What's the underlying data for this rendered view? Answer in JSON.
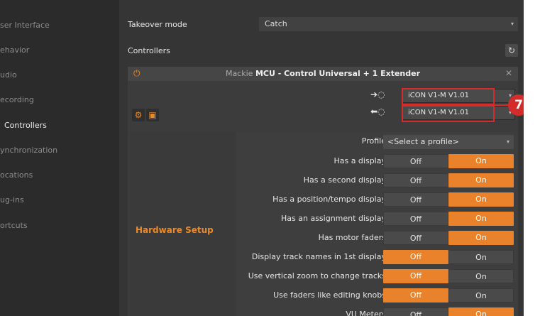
{
  "sidebar": {
    "items": [
      {
        "label": "ser Interface",
        "active": false
      },
      {
        "label": "ehavior",
        "active": false
      },
      {
        "label": "udio",
        "active": false
      },
      {
        "label": "ecording",
        "active": false
      },
      {
        "label": "Controllers",
        "active": true
      },
      {
        "label": "ynchronization",
        "active": false
      },
      {
        "label": "ocations",
        "active": false
      },
      {
        "label": "ug-ins",
        "active": false
      },
      {
        "label": "ortcuts",
        "active": false
      }
    ]
  },
  "takeover": {
    "label": "Takeover mode",
    "value": "Catch"
  },
  "controllers": {
    "label": "Controllers",
    "refresh_icon": "refresh-icon"
  },
  "card": {
    "brand": "Mackie",
    "model": "MCU - Control Universal + 1 Extender",
    "power_icon": "power-icon",
    "close_icon": "close-icon"
  },
  "ports": {
    "input_value": "iCON V1-M V1.01",
    "output_value": "iCON V1-M V1.01"
  },
  "annotation": {
    "number": "7",
    "color": "#d42b2b"
  },
  "hardware_setup": {
    "title": "Hardware Setup",
    "profile_label": "Profile",
    "profile_value": "<Select a profile>",
    "off_label": "Off",
    "on_label": "On",
    "options": [
      {
        "label": "Has a display",
        "state": "on"
      },
      {
        "label": "Has a second display",
        "state": "on"
      },
      {
        "label": "Has a position/tempo display",
        "state": "on"
      },
      {
        "label": "Has an assignment display",
        "state": "on"
      },
      {
        "label": "Has motor faders",
        "state": "on"
      },
      {
        "label": "Display track names in 1st display",
        "state": "off"
      },
      {
        "label": "Use vertical zoom to change tracks",
        "state": "off"
      },
      {
        "label": "Use faders like editing knobs",
        "state": "off"
      },
      {
        "label": "VU Meters",
        "state": "on"
      }
    ]
  },
  "colors": {
    "accent": "#e9822a",
    "panel": "#353535",
    "annotation": "#d42b2b"
  }
}
